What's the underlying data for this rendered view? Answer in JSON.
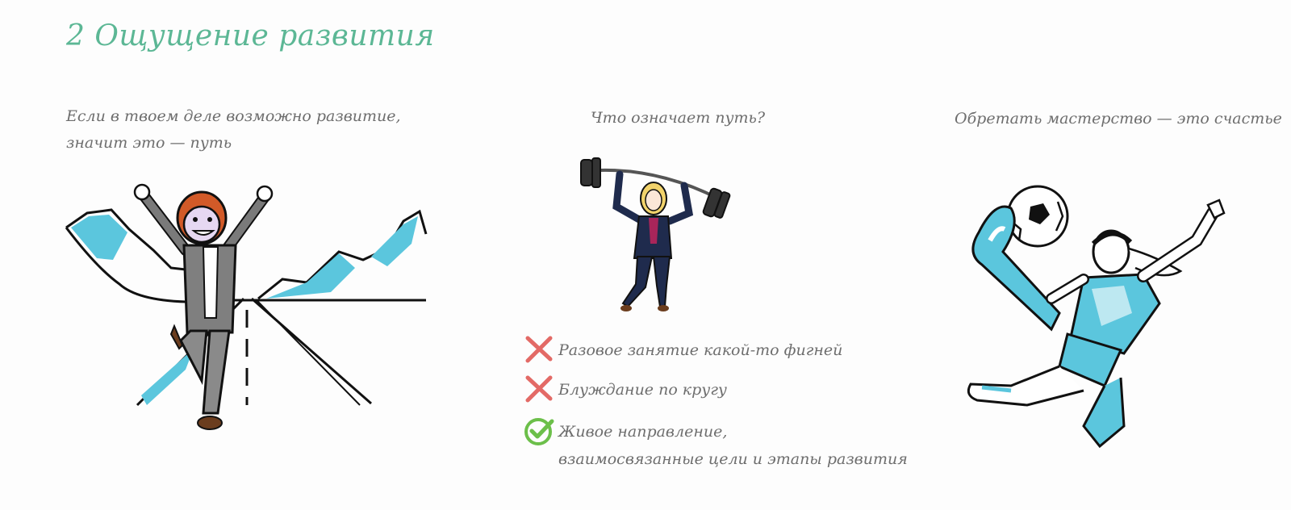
{
  "page": {
    "title": "2 Ощущение развития",
    "accent_color": "#5cb795",
    "text_color": "#6e6e6e",
    "illustration_color": "#5bc6dd"
  },
  "columns": [
    {
      "caption_lines": [
        "Если в твоем деле возможно развитие,",
        "значит это — путь"
      ],
      "illustration": "businessman-celebrating-on-mountain-road"
    },
    {
      "caption_lines": [
        "Что означает путь?"
      ],
      "illustration": "woman-lifting-barbell"
    },
    {
      "caption_lines": [
        "Обретать мастерство — это счастье"
      ],
      "illustration": "female-soccer-player-kicking-ball"
    }
  ],
  "checklist": [
    {
      "icon": "red-cross-icon",
      "status": "no",
      "color": "#e36a66",
      "lines": [
        "Разовое занятие какой-то фигней"
      ]
    },
    {
      "icon": "red-cross-icon",
      "status": "no",
      "color": "#e36a66",
      "lines": [
        "Блуждание по кругу"
      ]
    },
    {
      "icon": "green-check-icon",
      "status": "yes",
      "color": "#6cbf4a",
      "lines": [
        "Живое направление,",
        "взаимосвязанные цели и этапы развития"
      ]
    }
  ]
}
